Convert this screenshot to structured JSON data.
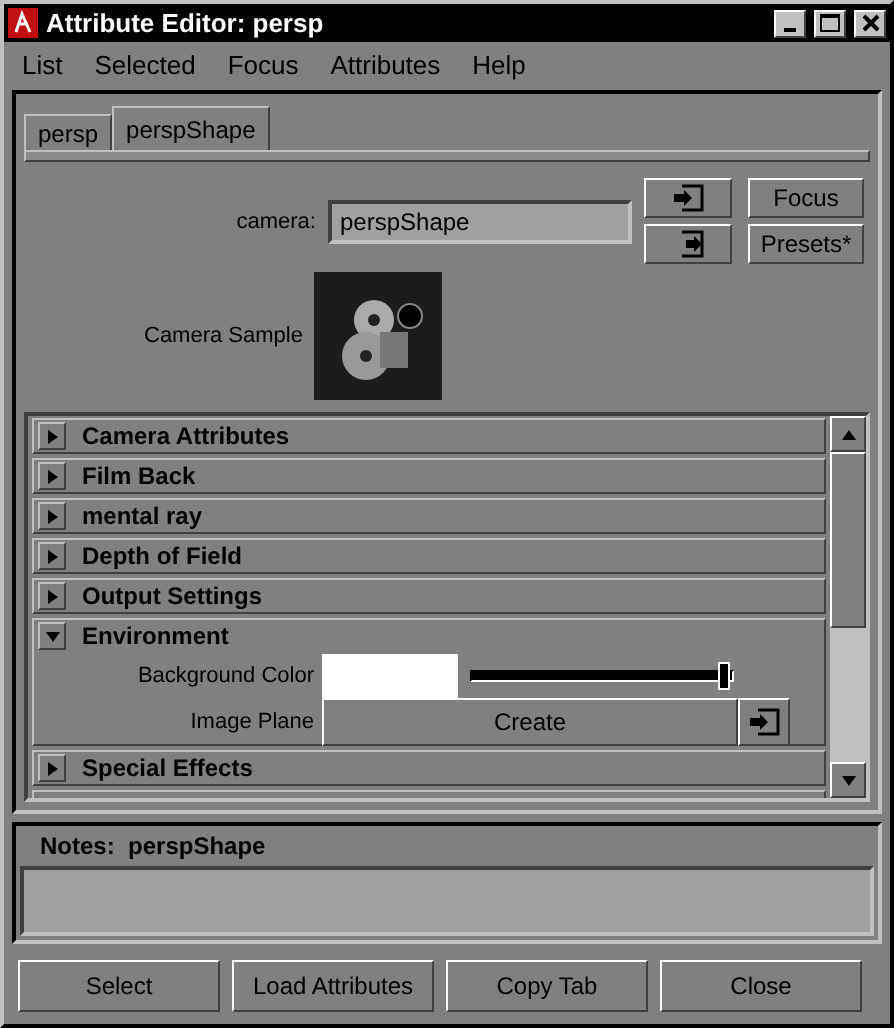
{
  "window": {
    "title": "Attribute Editor: persp"
  },
  "menu": [
    "List",
    "Selected",
    "Focus",
    "Attributes",
    "Help"
  ],
  "tabs": [
    {
      "label": "persp",
      "selected": false
    },
    {
      "label": "perspShape",
      "selected": true
    }
  ],
  "camera": {
    "label": "camera:",
    "value": "perspShape",
    "buttons": [
      "Focus",
      "Presets*"
    ]
  },
  "sample": {
    "label": "Camera Sample"
  },
  "sections": [
    {
      "title": "Camera Attributes",
      "expanded": false
    },
    {
      "title": "Film Back",
      "expanded": false
    },
    {
      "title": "mental ray",
      "expanded": false
    },
    {
      "title": "Depth of Field",
      "expanded": false
    },
    {
      "title": "Output Settings",
      "expanded": false
    },
    {
      "title": "Environment",
      "expanded": true,
      "attributes": [
        {
          "kind": "color",
          "label": "Background Color",
          "color": "#ffffff",
          "level": 0.97
        },
        {
          "kind": "button",
          "label": "Image Plane",
          "button": "Create"
        }
      ]
    },
    {
      "title": "Special Effects",
      "expanded": false
    }
  ],
  "notes": {
    "label": "Notes:",
    "name": "perspShape"
  },
  "buttons": [
    "Select",
    "Load Attributes",
    "Copy Tab",
    "Close"
  ]
}
